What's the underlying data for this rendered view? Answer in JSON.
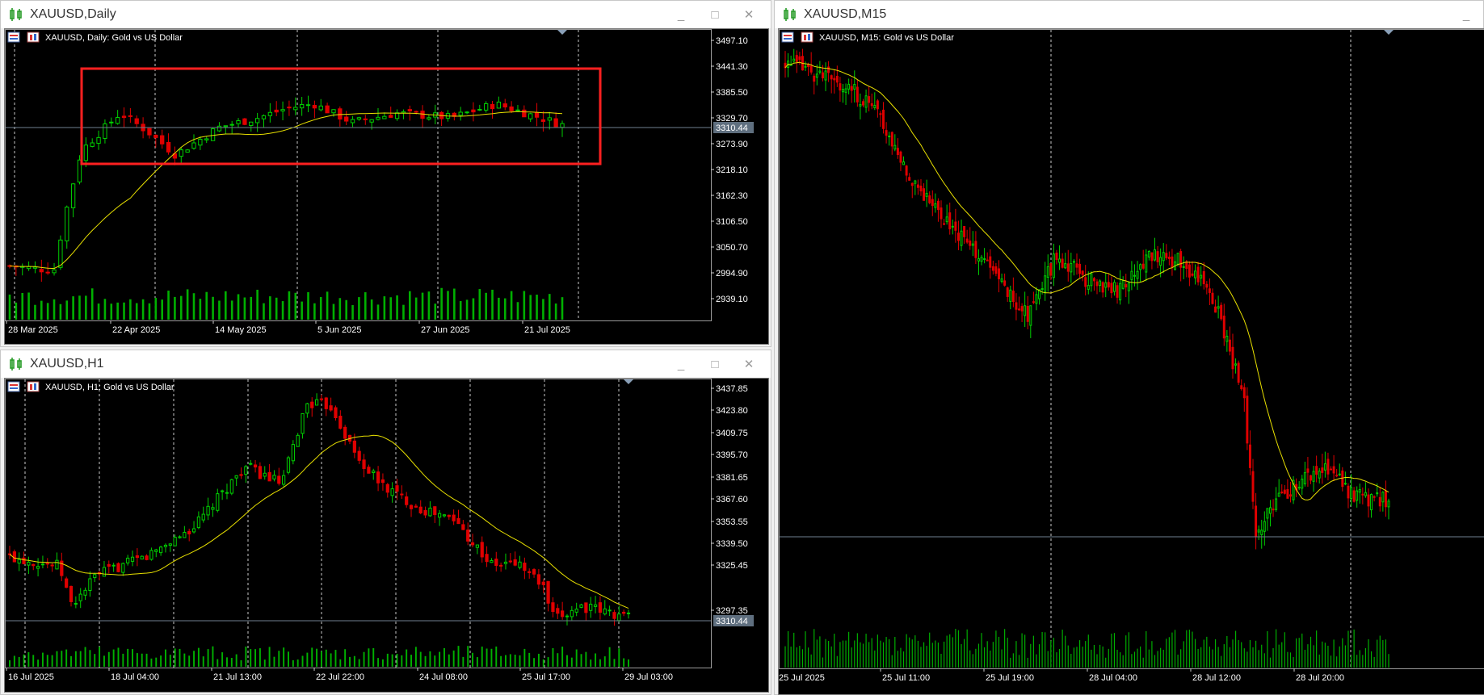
{
  "windows": {
    "daily": {
      "title": "XAUUSD,Daily",
      "header": "XAUUSD, Daily:  Gold vs US Dollar",
      "price_labels": [
        "3497.10",
        "3441.30",
        "3385.50",
        "3329.70",
        "3273.90",
        "3218.10",
        "3162.30",
        "3106.50",
        "3050.70",
        "2994.90",
        "2939.10"
      ],
      "current_price": "3310.44",
      "date_labels": [
        "28 Mar 2025",
        "22 Apr 2025",
        "14 May 2025",
        "5 Jun 2025",
        "27 Jun 2025",
        "21 Jul 2025"
      ]
    },
    "h1": {
      "title": "XAUUSD,H1",
      "header": "XAUUSD, H1:  Gold vs US Dollar",
      "price_labels": [
        "3437.85",
        "3423.80",
        "3409.75",
        "3395.70",
        "3381.65",
        "3367.60",
        "3353.55",
        "3339.50",
        "3325.45",
        "3297.35"
      ],
      "current_price": "3310.44",
      "date_labels": [
        "16 Jul 2025",
        "18 Jul 04:00",
        "21 Jul 13:00",
        "22 Jul 22:00",
        "24 Jul 08:00",
        "25 Jul 17:00",
        "29 Jul 03:00"
      ]
    },
    "m15": {
      "title": "XAUUSD,M15",
      "header": "XAUUSD, M15:  Gold vs US Dollar",
      "date_labels": [
        "25 Jul 2025",
        "25 Jul 11:00",
        "25 Jul 19:00",
        "28 Jul 04:00",
        "28 Jul 12:00",
        "28 Jul 20:00"
      ]
    }
  },
  "colors": {
    "bull": "#00d000",
    "bear": "#e00000",
    "ma": "#e8e000",
    "volume": "#00b000",
    "grid": "#c8c8c8",
    "price_line": "#6f7f8f",
    "highlight_box": "#ff2020"
  },
  "window_controls": {
    "minimize": "_",
    "maximize": "□",
    "close": "✕"
  }
}
